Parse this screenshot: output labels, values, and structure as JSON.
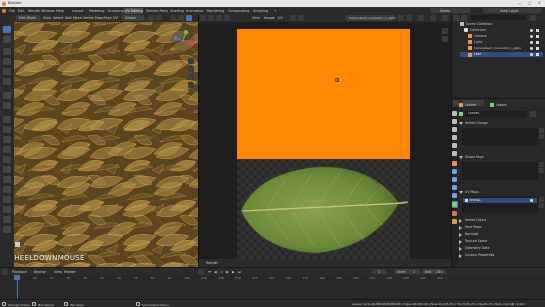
{
  "window": {
    "title": "Blender"
  },
  "menu": [
    "File",
    "Edit",
    "Render",
    "Window",
    "Help"
  ],
  "workspace_tabs": [
    "Layout",
    "Modeling",
    "Sculpting",
    "UV Editing",
    "Texture Paint",
    "Shading",
    "Animation",
    "Rendering",
    "Compositing",
    "Scripting"
  ],
  "active_tab": "UV Editing",
  "scene": {
    "name": "Scene",
    "view_layer": "View Layer"
  },
  "left_header": {
    "mode": "Edit Mode",
    "view": "View",
    "select": "Select",
    "add": "Add",
    "mesh": "Mesh",
    "vertex": "Vertex",
    "edge": "Edge",
    "face": "Face",
    "uv": "UV",
    "orientation": "Global"
  },
  "center_header": {
    "view": "View",
    "image": "Image",
    "uv": "UV",
    "filename": "TexturedLeaf_covered(1)_1_alpha"
  },
  "center_footer": {
    "label": "Render"
  },
  "overlay_text": "WHEELDOWNMOUSE",
  "outliner": {
    "search_placeholder": "",
    "items": [
      "Scene Collection",
      "Collection",
      "Camera",
      "Light",
      "TexturedLeaf_covered(1)_1_alpha",
      "Leaf"
    ]
  },
  "properties": {
    "tabs": [
      "Leaves",
      "Leaves"
    ],
    "data_name": "Leaves",
    "sections": [
      {
        "label": "Vertex Groups",
        "open": true
      },
      {
        "label": "Shape Keys",
        "open": true
      },
      {
        "label": "UV Maps",
        "open": true
      },
      {
        "label": "Vertex Colors",
        "open": false
      },
      {
        "label": "Face Maps",
        "open": false
      },
      {
        "label": "Normals",
        "open": false
      },
      {
        "label": "Texture Space",
        "open": false
      },
      {
        "label": "Geometry Data",
        "open": false
      },
      {
        "label": "Custom Properties",
        "open": false
      }
    ],
    "uv_map_name": "UVMap"
  },
  "timeline": {
    "menu": [
      "Playback",
      "Keying",
      "View",
      "Marker"
    ],
    "current_frame": "1",
    "start_label": "Start",
    "start": "1",
    "end_label": "End",
    "end": "250",
    "ruler": [
      "0",
      "10",
      "20",
      "30",
      "40",
      "50",
      "60",
      "70",
      "80",
      "90",
      "100",
      "110",
      "120",
      "130",
      "140",
      "150",
      "160",
      "170",
      "180",
      "190",
      "200",
      "210",
      "220",
      "230",
      "240",
      "250"
    ]
  },
  "statusbar": {
    "left": "Change Frame",
    "middle1": "Box Select",
    "middle2": "Pan View",
    "middle3": "Sel Context Menu",
    "right": "Leaves | Verts:4/4,808,400/8,808,400 | Edges:4/4,808,400 | Faces:2/1,515,151 | Tris:3,535,151 | Objects:1/3 | Mem: 2.04 GiB | 2.90.0"
  },
  "colors": {
    "orange": "#ff8800",
    "leaf_green": "#6b8a3a",
    "accent_blue": "#4772b3"
  }
}
